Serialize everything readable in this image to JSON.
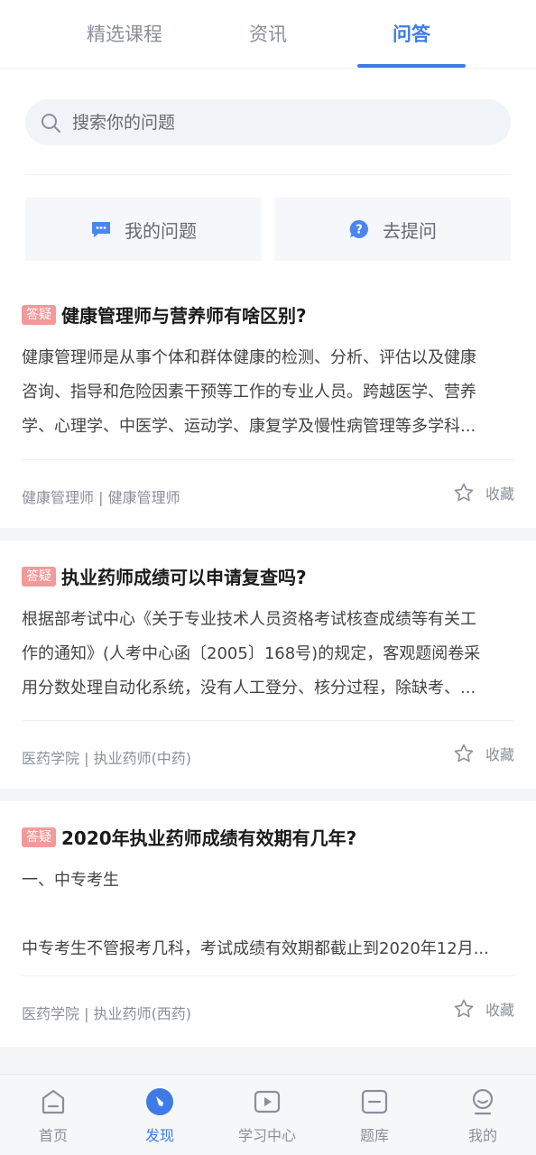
{
  "tabs": [
    {
      "label": "精选课程",
      "active": false
    },
    {
      "label": "资讯",
      "active": false
    },
    {
      "label": "问答",
      "active": true
    }
  ],
  "search": {
    "placeholder": "搜索你的问题",
    "icon": "search-icon"
  },
  "actions": [
    {
      "label": "我的问题",
      "icon": "chat-bubble-icon"
    },
    {
      "label": "去提问",
      "icon": "question-bubble-icon"
    }
  ],
  "questions": [
    {
      "tag": "答疑",
      "title": "健康管理师与营养师有啥区别?",
      "body": [
        "健康管理师是从事个体和群体健康的检测、分析、评估以及健康",
        "咨询、指导和危险因素干预等工作的专业人员。跨越医学、营养",
        "学、心理学、中医学、运动学、康复学及慢性病管理等多学科..."
      ],
      "meta": "健康管理师 | 健康管理师",
      "fav_label": "收藏"
    },
    {
      "tag": "答疑",
      "title": "执业药师成绩可以申请复查吗?",
      "body": [
        "根据部考试中心《关于专业技术人员资格考试核查成绩等有关工",
        "作的通知》(人考中心函〔2005〕168号)的规定，客观题阅卷采",
        "用分数处理自动化系统，没有人工登分、核分过程，除缺考、..."
      ],
      "meta": "医药学院 | 执业药师(中药)",
      "fav_label": "收藏"
    },
    {
      "tag": "答疑",
      "title": "2020年执业药师成绩有效期有几年?",
      "body": [
        "一、中专考生",
        "",
        "中专考生不管报考几科，考试成绩有效期都截止到2020年12月..."
      ],
      "meta": "医药学院 | 执业药师(西药)",
      "fav_label": "收藏"
    }
  ],
  "bottom_nav": [
    {
      "label": "首页",
      "icon": "home-icon",
      "active": false
    },
    {
      "label": "发现",
      "icon": "compass-icon",
      "active": true
    },
    {
      "label": "学习中心",
      "icon": "play-icon",
      "active": false
    },
    {
      "label": "题库",
      "icon": "question-bank-icon",
      "active": false
    },
    {
      "label": "我的",
      "icon": "profile-icon",
      "active": false
    }
  ],
  "colors": {
    "accent": "#3f7be6",
    "tag": "#f29a9a",
    "muted": "#8a8f99"
  }
}
